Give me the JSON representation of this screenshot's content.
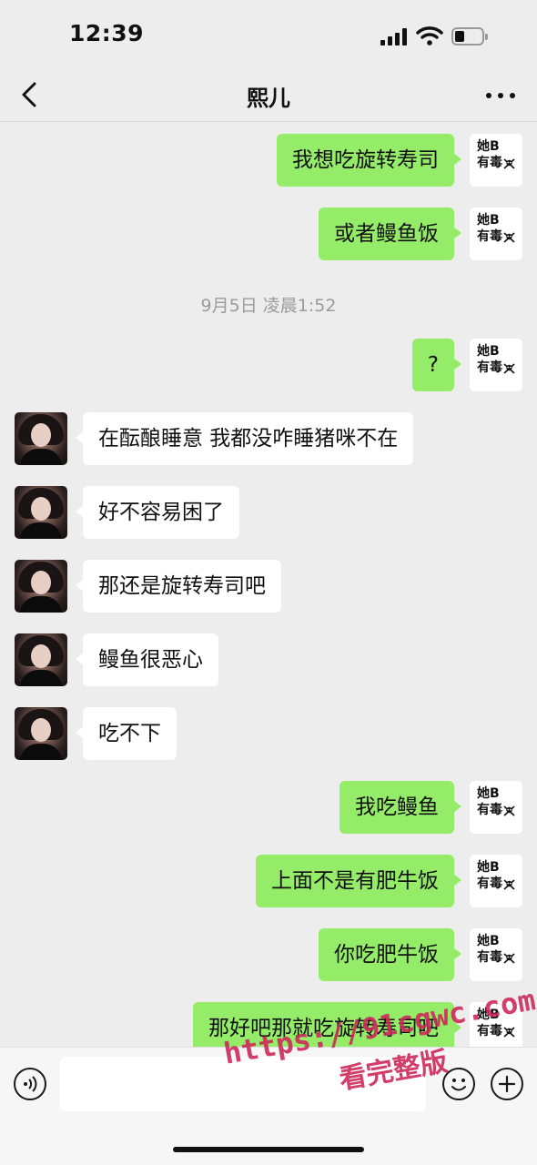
{
  "status_bar": {
    "time": "12:39"
  },
  "header": {
    "title": "熙儿"
  },
  "self_avatar": {
    "line1": "她B",
    "line2": "有毒"
  },
  "timestamp": "9月5日 凌晨1:52",
  "messages": [
    {
      "side": "out",
      "text": "我想吃旋转寿司"
    },
    {
      "side": "out",
      "text": "或者鳗鱼饭"
    },
    {
      "side": "out",
      "text": "?"
    },
    {
      "side": "in",
      "text": "在酝酿睡意 我都没咋睡猪咪不在"
    },
    {
      "side": "in",
      "text": "好不容易困了"
    },
    {
      "side": "in",
      "text": "那还是旋转寿司吧"
    },
    {
      "side": "in",
      "text": "鳗鱼很恶心"
    },
    {
      "side": "in",
      "text": "吃不下"
    },
    {
      "side": "out",
      "text": "我吃鳗鱼"
    },
    {
      "side": "out",
      "text": "上面不是有肥牛饭"
    },
    {
      "side": "out",
      "text": "你吃肥牛饭"
    },
    {
      "side": "out",
      "text": "那好吧那就吃旋转寿司吧"
    }
  ],
  "input_bar": {
    "placeholder": ""
  },
  "watermark": {
    "line1": "https://91cgwc.com",
    "line2": "看完整版"
  },
  "colors": {
    "outgoing_bubble": "#95ec69",
    "incoming_bubble": "#ffffff",
    "background": "#ededed"
  }
}
